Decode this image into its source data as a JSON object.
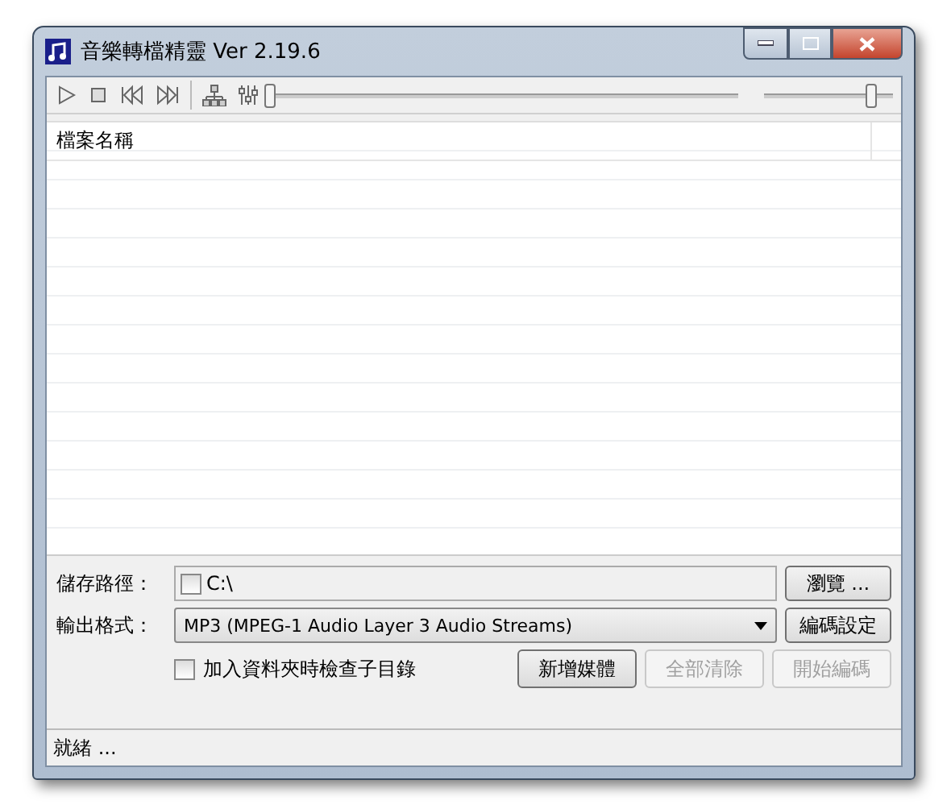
{
  "window": {
    "title": "音樂轉檔精靈 Ver 2.19.6"
  },
  "player": {
    "seek": {
      "level": 0
    },
    "volume": {
      "level": 0.82
    }
  },
  "file_list": {
    "columns": [
      "檔案名稱"
    ]
  },
  "save_path": {
    "label": "儲存路徑：",
    "checked": false,
    "value": "C:\\",
    "browse_button": "瀏覽 ..."
  },
  "output_format": {
    "label": "輸出格式：",
    "value": "MP3 (MPEG-1 Audio Layer 3 Audio Streams)",
    "settings_button": "編碼設定"
  },
  "subfolder_option": {
    "label": "加入資料夾時檢查子目錄",
    "checked": false
  },
  "actions": [
    {
      "label": "新增媒體",
      "disabled": false
    },
    {
      "label": "全部清除",
      "disabled": true
    },
    {
      "label": "開始編碼",
      "disabled": true
    }
  ],
  "status_bar": {
    "text": "就緒 ..."
  }
}
